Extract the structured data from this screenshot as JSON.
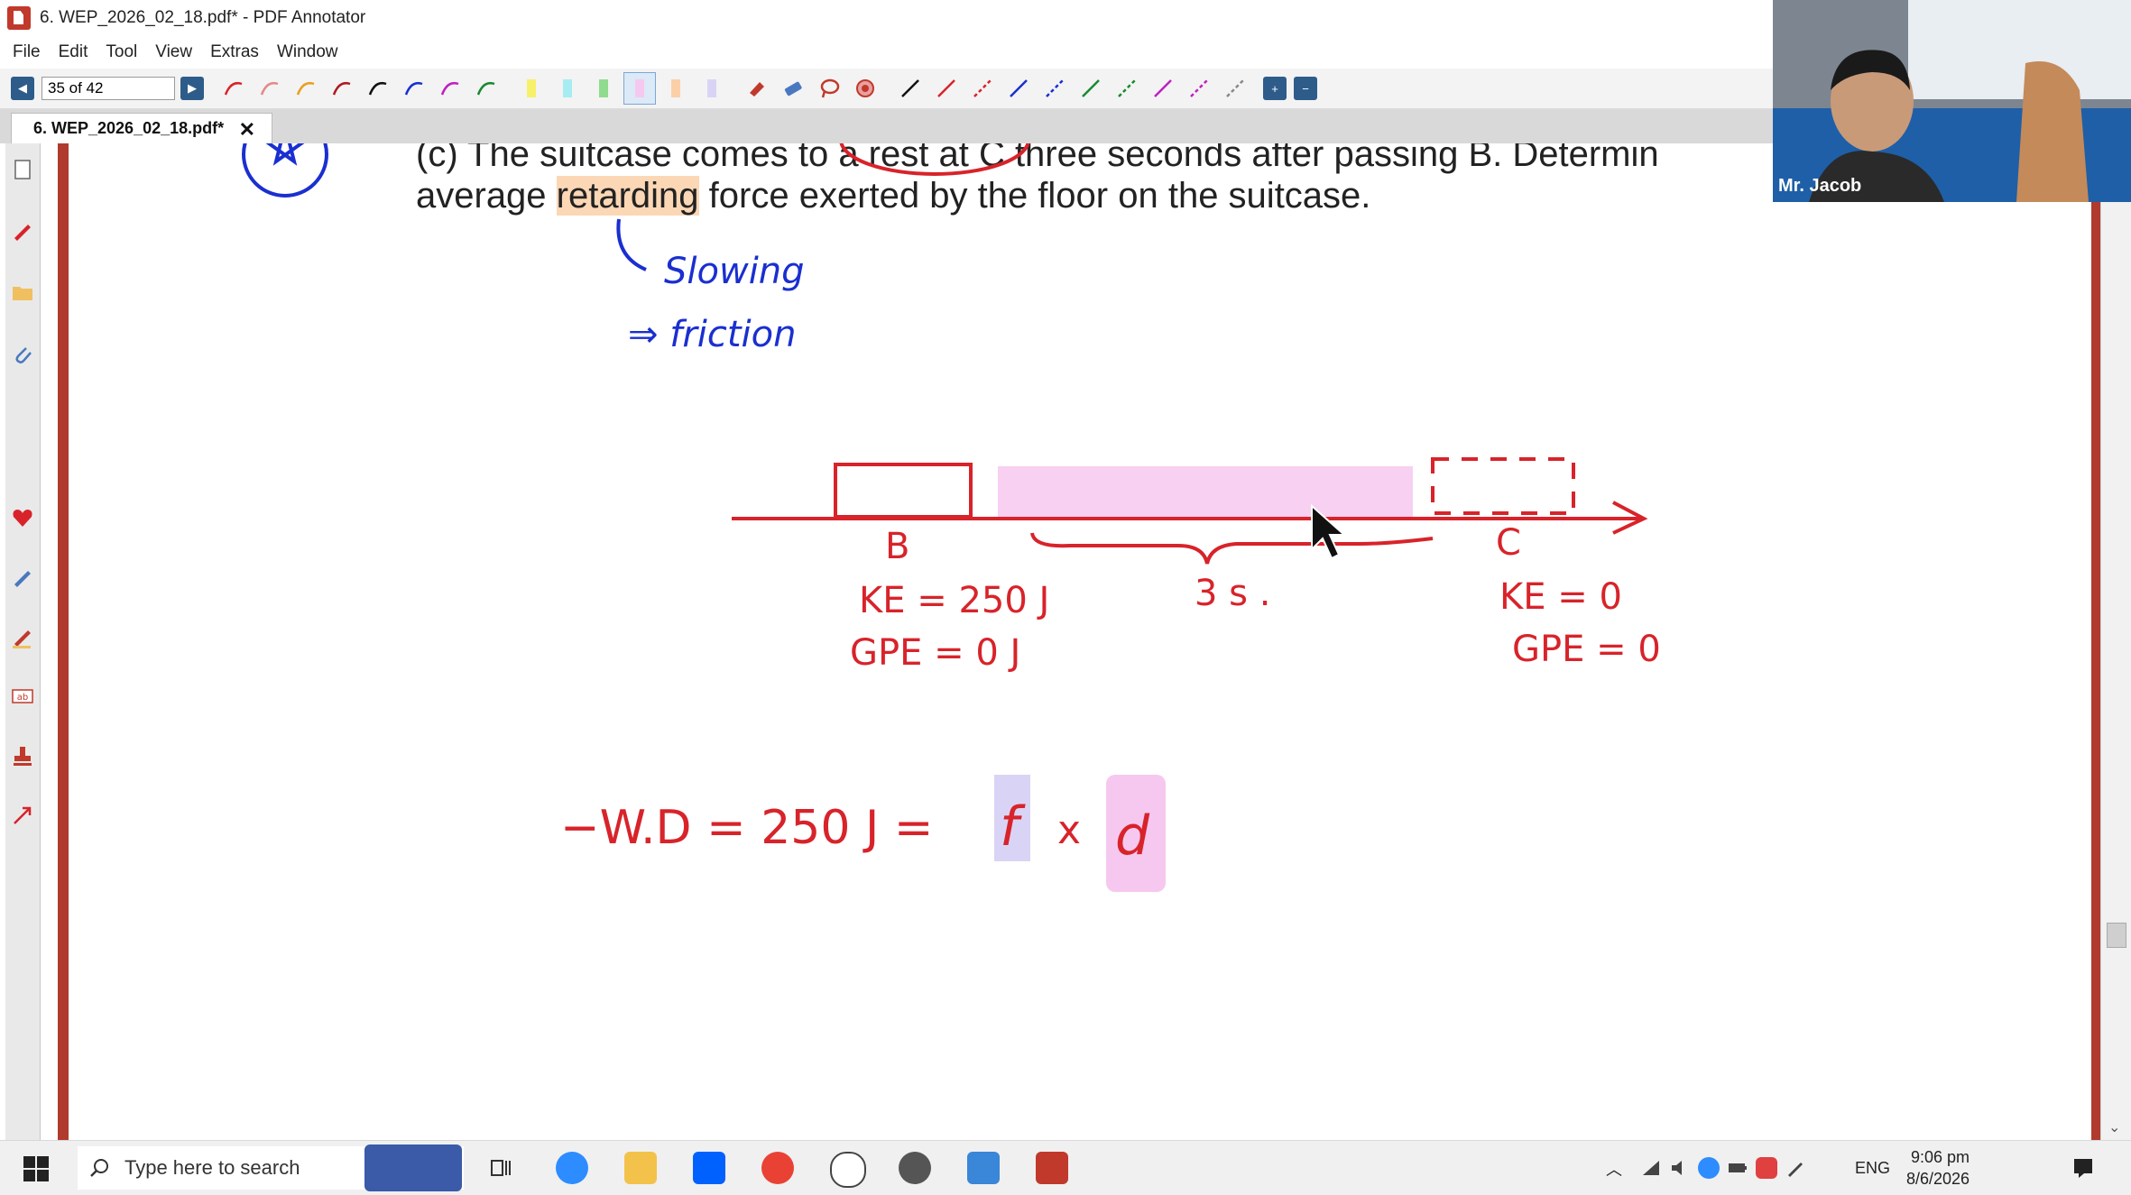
{
  "window": {
    "title": "6. WEP_2026_02_18.pdf* - PDF Annotator"
  },
  "menu": [
    "File",
    "Edit",
    "Tool",
    "View",
    "Extras",
    "Window"
  ],
  "toolbar": {
    "page_indicator": "35 of 42"
  },
  "tab": {
    "label": "6. WEP_2026_02_18.pdf*",
    "close": "✕"
  },
  "document": {
    "line1": "(c)  The suitcase comes to a rest at C three seconds after passing B.  Determin",
    "line2_pre": "average ",
    "line2_highlight": "retarding",
    "line2_post": " force exerted by the floor on the suitcase."
  },
  "annotations": {
    "slowing": "Slowing",
    "friction": "⇒ friction",
    "label_b": "B",
    "label_c": "C",
    "ke_b": "KE = 250 J",
    "gpe_b": "GPE = 0 J",
    "time": "3 s .",
    "ke_c": "KE = 0",
    "gpe_c": "GPE = 0",
    "equation_left": "−W.D = 250 J  =",
    "equation_f": "f",
    "equation_x": "x",
    "equation_d": "d"
  },
  "webcam": {
    "name": "Mr. Jacob"
  },
  "taskbar": {
    "search_placeholder": "Type here to search",
    "language": "ENG",
    "time": "9:06 pm",
    "date": "8/6/2026"
  },
  "colors": {
    "ink_red": "#d8232a",
    "ink_blue": "#1a2fd0",
    "highlight_pink": "#f6c8f0",
    "highlight_lavender": "#d9d4f5",
    "app_red": "#c0392b"
  }
}
